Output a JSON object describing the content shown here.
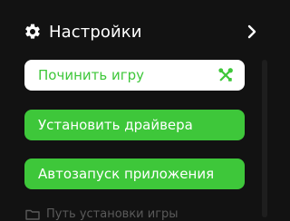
{
  "header": {
    "title": "Настройки",
    "icon": "gear-icon",
    "expand_icon": "chevron-right-icon"
  },
  "buttons": {
    "fix_game": {
      "label": "Починить игру",
      "icon": "wrench-screwdriver-icon"
    },
    "install_drivers": {
      "label": "Установить драйвера"
    },
    "autorun": {
      "label": "Автозапуск приложения"
    }
  },
  "install_path": {
    "label": "Путь установки игры",
    "icon": "folder-icon"
  },
  "colors": {
    "background": "#121212",
    "accent_green": "#3ec73a",
    "white": "#ffffff",
    "muted_text": "#5a5a5a"
  }
}
